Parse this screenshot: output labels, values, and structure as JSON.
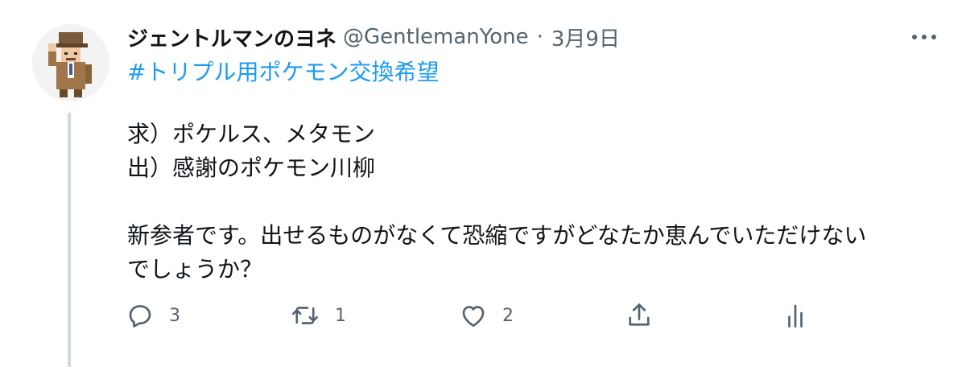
{
  "author": {
    "display_name": "ジェントルマンのヨネ",
    "handle": "@GentlemanYone",
    "separator": "·",
    "date": "3月9日",
    "avatar_icon": "gentleman-pixel-avatar"
  },
  "tweet": {
    "hashtag": "#トリプル用ポケモン交換希望",
    "lines": [
      "求）ポケルス、メタモン",
      "出）感謝のポケモン川柳"
    ],
    "paragraph_lines": [
      "新参者です。出せるものがなくて恐縮ですがどなたか恵んでいただけない",
      "でしょうか？"
    ]
  },
  "actions": {
    "reply_count": "3",
    "retweet_count": "1",
    "like_count": "2"
  },
  "colors": {
    "link": "#1d9bf0",
    "muted": "#536471",
    "text": "#0f1419",
    "thread_line": "#cfd9de"
  }
}
